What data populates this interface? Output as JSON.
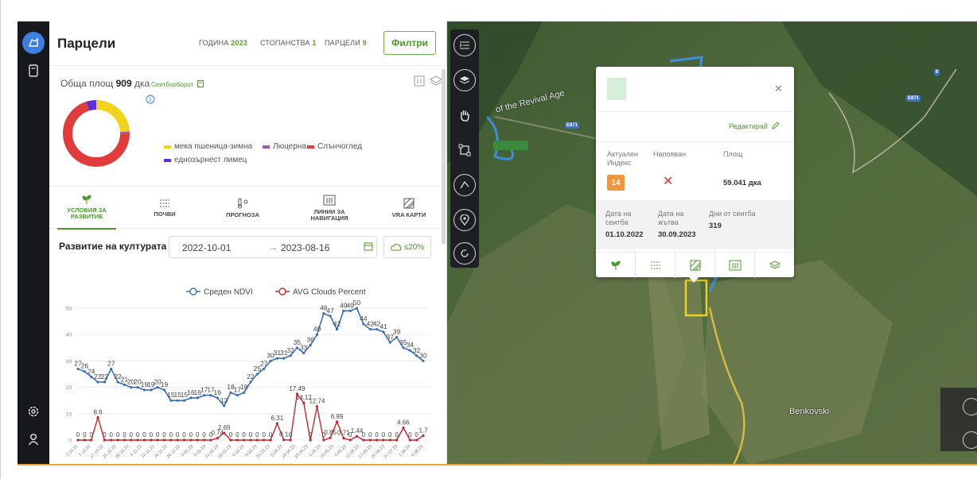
{
  "panel": {
    "title": "Парцели",
    "stats": [
      {
        "label": "ГОДИНА",
        "value": "2023"
      },
      {
        "label": "СТОПАНСТВА",
        "value": "1"
      },
      {
        "label": "ПАРЦЕЛИ",
        "value": "9"
      }
    ],
    "filters_label": "Филтри",
    "area_prefix": "Обща площ",
    "area_value": "909",
    "area_unit": "дка",
    "rotation_label": "Сеитбооборот",
    "crops": [
      {
        "name": "мека пшеница-зимна",
        "color": "#f2d31b",
        "share": 0.24
      },
      {
        "name": "Люцерна",
        "color": "#9b59b6",
        "share": 0.01
      },
      {
        "name": "Слънчоглед",
        "color": "#e23b3b",
        "share": 0.7
      },
      {
        "name": "еднозърнест лимец",
        "color": "#5b2fe0",
        "share": 0.05
      }
    ]
  },
  "tabs": [
    {
      "line1": "УСЛОВИЯ ЗА",
      "line2": "РАЗВИТИЕ",
      "icon": "sprout-icon",
      "active": true
    },
    {
      "line1": "ПОЧВИ",
      "line2": "",
      "icon": "soil-icon",
      "active": false
    },
    {
      "line1": "ПРОГНОЗА",
      "line2": "",
      "icon": "weather-icon",
      "active": false
    },
    {
      "line1": "ЛИНИИ ЗА",
      "line2": "НАВИГАЦИЯ",
      "icon": "navigation-lines-icon",
      "active": false
    },
    {
      "line1": "VRA КАРТИ",
      "line2": "",
      "icon": "vra-map-icon",
      "active": false
    }
  ],
  "development": {
    "title": "Развитие на културата",
    "date_from": "2022-10-01",
    "date_to": "2023-08-16",
    "cloud_filter": "≤20%"
  },
  "chart_data": {
    "type": "line",
    "ylim": [
      0,
      55
    ],
    "yticks": [
      "50",
      "40",
      "30",
      "20",
      "10",
      "0"
    ],
    "x": [
      "2.10.22",
      "7.10.22",
      "17.10.22",
      "25.10.22",
      "30.10.22",
      "4.11.22",
      "14.11.22",
      "26.11.22",
      "29.12.22",
      "3.01.23",
      "8.01.23",
      "14.02.23",
      "19.02.23",
      "6.03.23",
      "9.03.23",
      "25.03.23",
      "5.04.23",
      "10.04.23",
      "15.04.23",
      "2.05.23",
      "19.05.23",
      "4.06.23",
      "12.06.23",
      "17.06.23",
      "22.06.23",
      "27.07.23",
      "1.08.23",
      "6.08.23"
    ],
    "series": [
      {
        "name": "Среден NDVI",
        "color": "#3a6fb5",
        "values": [
          27,
          26,
          24,
          22,
          22,
          27,
          22,
          21,
          20,
          20,
          19,
          19,
          20,
          19,
          15,
          15,
          15,
          16,
          16,
          17,
          17,
          16,
          13,
          18,
          17,
          18,
          22,
          25,
          27,
          30,
          31,
          31,
          32,
          35,
          33,
          36,
          40,
          48,
          47,
          42,
          49,
          49,
          50,
          44,
          42,
          42,
          41,
          37,
          39,
          35,
          34,
          32,
          30
        ],
        "labels": [
          "27",
          "26",
          "24",
          "22",
          "22",
          "27",
          "22",
          "21",
          "20",
          "20",
          "19",
          "19",
          "20",
          "19",
          "15",
          "15",
          "15",
          "16",
          "16",
          "17",
          "17",
          "16",
          "13",
          "18",
          "17",
          "18",
          "22",
          "25",
          "27",
          "30",
          "31",
          "31",
          "32",
          "35",
          "33",
          "36",
          "40",
          "48",
          "47",
          "42",
          "49",
          "49",
          "50",
          "44",
          "42",
          "42",
          "41",
          "37",
          "39",
          "35",
          "34",
          "32",
          "30"
        ]
      },
      {
        "name": "AVG Clouds Percent",
        "color": "#c0282d",
        "values": [
          0,
          0,
          0,
          8.6,
          0,
          0,
          0,
          0,
          0,
          0,
          0,
          0,
          0,
          0,
          0,
          0,
          0,
          0,
          0,
          0,
          0,
          0.74,
          2.69,
          0,
          0,
          0,
          0,
          0,
          0,
          0,
          6.31,
          0.1,
          0,
          17.49,
          14.12,
          0,
          12.74,
          0,
          0.85,
          6.99,
          0.71,
          0,
          1.44,
          0,
          0,
          0,
          0,
          0,
          0,
          4.66,
          0,
          0,
          1.7
        ],
        "labels": [
          "0",
          "0",
          "0",
          "8.6",
          "0",
          "0",
          "0",
          "0",
          "0",
          "0",
          "0",
          "0",
          "0",
          "0",
          "0",
          "0",
          "0",
          "0",
          "0",
          "0",
          "0",
          "0.74",
          "2.69",
          "0",
          "0",
          "0",
          "0",
          "0",
          "0",
          "0",
          "6.31",
          "0.1",
          "0",
          "17.49",
          "14.12",
          "0",
          "12.74",
          "0",
          "0.85",
          "6.99",
          "0.71",
          "0",
          "1.44",
          "0",
          "0",
          "0",
          "0",
          "0",
          "0",
          "4.66",
          "0",
          "0",
          "1.7"
        ]
      }
    ]
  },
  "map": {
    "labels": [
      "of the Revival Age",
      "Benkovski"
    ],
    "road_badges": [
      "E871",
      "E871",
      "6"
    ],
    "popup": {
      "edit_label": "Редактирай",
      "index_label": "Актуален Индекс",
      "index_value": "14",
      "irrigated_label": "Напояван",
      "irrigated_value": "✕",
      "area_label": "Площ",
      "area_value": "59.041 дка",
      "sowing_label": "Дата на сеитба",
      "sowing_value": "01.10.2022",
      "harvest_label": "Дата на жътва",
      "harvest_value": "30.09.2023",
      "days_label": "Дни от сеитба",
      "days_value": "319"
    }
  },
  "colors": {
    "accent": "#4a9a2a",
    "rail": "#17181c",
    "popup_badge": "#f0963c"
  }
}
